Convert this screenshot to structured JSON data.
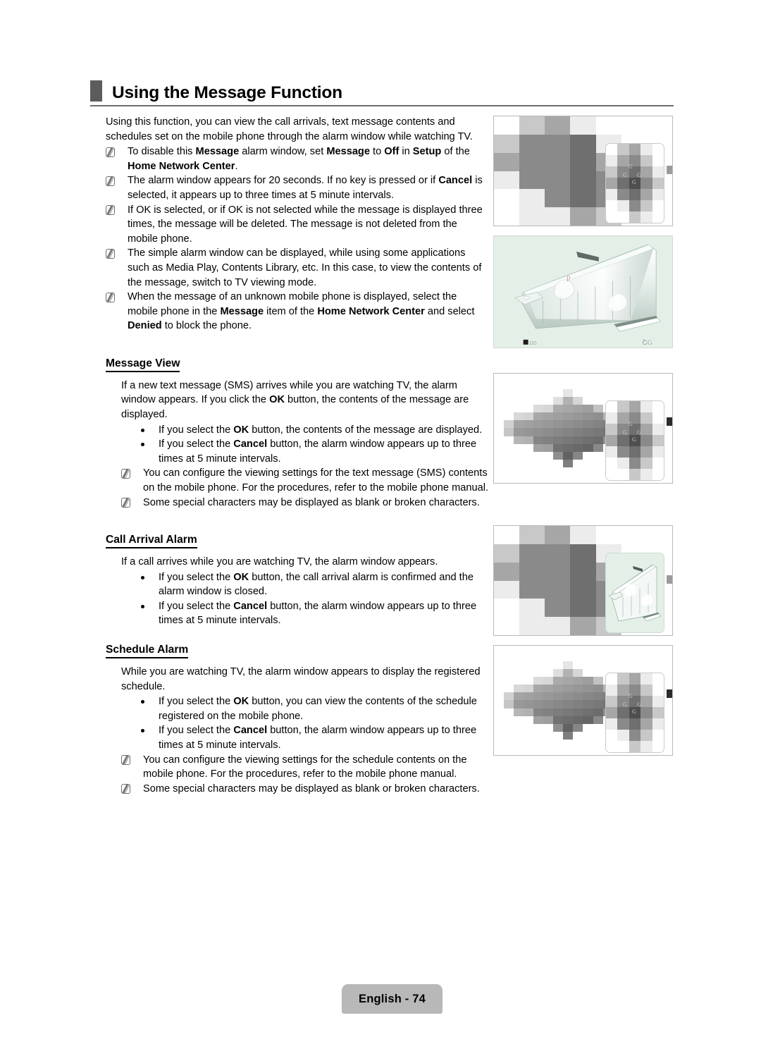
{
  "document": {
    "heading": "Using the Message Function",
    "footer_label": "English - 74"
  },
  "intro": {
    "paragraph": "Using this function, you can view the call arrivals, text message contents and schedules set on the mobile phone through the alarm window while watching TV.",
    "notes": [
      "To disable this Message alarm window, set Message to Off in Setup of the Home Network Center.",
      "The alarm window appears for 20 seconds. If no key is pressed or if Cancel is selected, it appears up to three times at 5 minute intervals.",
      "If OK is selected, or if OK is not selected while the message is displayed three times, the message will be deleted. The message is not deleted from the mobile phone.",
      "The simple alarm window can be displayed, while using some applications such as Media Play, Contents Library, etc. In this case, to view the contents of the message, switch to TV viewing mode.",
      "When the message of an unknown mobile phone is displayed, select the mobile phone in the Message item of the Home Network Center and select Denied to block the phone."
    ]
  },
  "sections": [
    {
      "title": "Message View",
      "paragraph": "If a new text message (SMS) arrives while you are watching TV, the alarm window appears. If you click the OK button, the contents of the message are displayed.",
      "bullets": [
        "If you select the OK button, the contents of the message are displayed.",
        "If you select the Cancel button, the alarm window appears up to three times at 5 minute intervals."
      ],
      "notes": [
        "You can configure the viewing settings for the text message (SMS) contents on the mobile phone. For the procedures, refer to the mobile phone manual.",
        "Some special characters may be displayed as blank or broken characters."
      ]
    },
    {
      "title": "Call Arrival Alarm",
      "paragraph": "If a call arrives while you are watching TV, the alarm window appears.",
      "bullets": [
        "If you select the OK button, the call arrival alarm is confirmed and the alarm window is closed.",
        "If you select the Cancel button, the alarm window appears up to three times at 5 minute intervals."
      ],
      "notes": []
    },
    {
      "title": "Schedule Alarm",
      "paragraph": "While you are watching TV, the alarm window appears to display the registered schedule.",
      "bullets": [
        "If you select the OK button, you can view the contents of the schedule registered on the mobile phone.",
        "If you select the Cancel button, the alarm window appears up to three times at 5 minute intervals."
      ],
      "notes": [
        "You can configure the viewing settings for the schedule contents on the mobile phone. For the procedures, refer to the mobile phone manual.",
        "Some special characters may be displayed as blank or broken characters."
      ]
    }
  ],
  "figures": [
    {
      "name": "message-alarm-window-figure",
      "kind": "pixelated-screen-with-popup"
    },
    {
      "name": "simple-alarm-window-figure",
      "kind": "device-render-mint"
    },
    {
      "name": "message-view-figure",
      "kind": "pixelated-gradient-with-popup"
    },
    {
      "name": "call-arrival-alarm-figure",
      "kind": "pixelated-screen-with-device-card"
    },
    {
      "name": "schedule-alarm-figure",
      "kind": "pixelated-gradient-with-popup"
    }
  ],
  "colors": {
    "heading_marker": "#5c5c5c",
    "heading_rule": "#6d6d6d",
    "footer_background": "#b8b8b8",
    "figure_border": "#b9b9b9",
    "mint_panel": "#e4efe7",
    "text": "#000000"
  }
}
